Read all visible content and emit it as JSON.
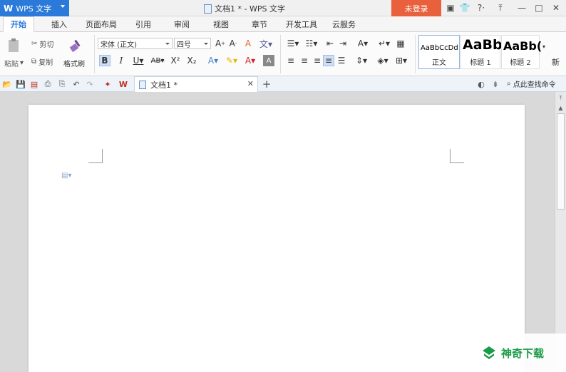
{
  "titlebar": {
    "app_name": "WPS 文字",
    "document_title": "文档1 * - WPS 文字",
    "login_label": "未登录"
  },
  "menu": {
    "tabs": [
      "开始",
      "插入",
      "页面布局",
      "引用",
      "审阅",
      "视图",
      "章节",
      "开发工具",
      "云服务"
    ]
  },
  "ribbon": {
    "clipboard": {
      "paste": "粘贴",
      "cut": "剪切",
      "copy": "复制",
      "format_painter": "格式刷"
    },
    "font": {
      "name": "宋体 (正文)",
      "size": "四号"
    },
    "styles": [
      {
        "sample": "AaBbCcDd",
        "name": "正文"
      },
      {
        "sample": "AaBb",
        "name": "标题 1"
      },
      {
        "sample": "AaBb(",
        "name": "标题 2"
      }
    ],
    "new_style": "新"
  },
  "doc_tabs": {
    "active": "文档1 *",
    "find_command": "点此查找命令"
  },
  "watermark": {
    "brand": "神奇下载"
  },
  "colors": {
    "accent": "#2b79d8",
    "login": "#e8603c",
    "brand_green": "#1a9b48"
  }
}
